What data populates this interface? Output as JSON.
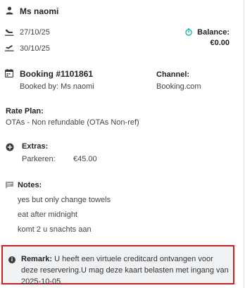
{
  "guest": {
    "name": "Ms naomi"
  },
  "dates": {
    "arrival": "27/10/25",
    "departure": "30/10/25"
  },
  "balance": {
    "label": "Balance:",
    "value": "€0.00",
    "accent": "#1bb3a3"
  },
  "booking": {
    "title": "Booking #1101861",
    "booked_by": "Booked by: Ms naomi",
    "channel_label": "Channel:",
    "channel_value": "Booking.com"
  },
  "rate_plan": {
    "label": "Rate Plan:",
    "value": "OTAs - Non refundable (OTAs Non-ref)"
  },
  "extras": {
    "label": "Extras:",
    "items": [
      {
        "name": "Parkeren:",
        "price": "€45.00"
      }
    ]
  },
  "notes": {
    "label": "Notes:",
    "lines": [
      "yes but only change towels",
      "eat after midnight",
      "komt 2 u snachts aan"
    ]
  },
  "remark": {
    "label": "Remark:",
    "text": "U heeft een virtuele creditcard ontvangen voor deze reservering.U mag deze kaart belasten met ingang van 2025-10-05.",
    "border_color": "#d11f1f"
  }
}
